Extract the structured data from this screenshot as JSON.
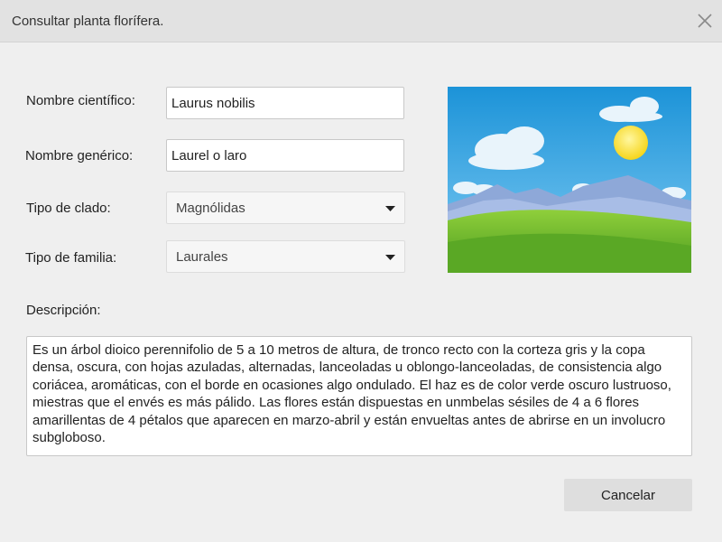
{
  "dialog": {
    "title": "Consultar planta florífera."
  },
  "form": {
    "scientific_name": {
      "label": "Nombre científico:",
      "value": "Laurus nobilis"
    },
    "generic_name": {
      "label": "Nombre genérico:",
      "value": "Laurel o laro"
    },
    "clade": {
      "label": "Tipo de clado:",
      "selected": "Magnólidas"
    },
    "family": {
      "label": "Tipo de familia:",
      "selected": "Laurales"
    },
    "description": {
      "label": "Descripción:",
      "value": "Es un árbol dioico perennifolio de 5 a 10 metros de altura, de tronco recto con la corteza gris y la copa densa, oscura, con hojas azuladas, alternadas, lanceoladas u oblongo-lanceoladas, de consistencia algo coriácea, aromáticas, con el borde en ocasiones algo ondulado. El haz es de color verde oscuro lustruoso, miestras que el envés es más pálido. Las flores están dispuestas en unmbelas sésiles de 4 a 6 flores amarillentas de 4 pétalos que aparecen en marzo-abril y están envueltas antes de abrirse en un involucro subgloboso."
    }
  },
  "actions": {
    "cancel_label": "Cancelar"
  },
  "icons": {
    "close": "close-icon",
    "dropdown": "chevron-down-icon",
    "image": "landscape-placeholder-image"
  },
  "colors": {
    "titlebar": "#e2e2e2",
    "background": "#efefef",
    "button": "#dedede"
  }
}
